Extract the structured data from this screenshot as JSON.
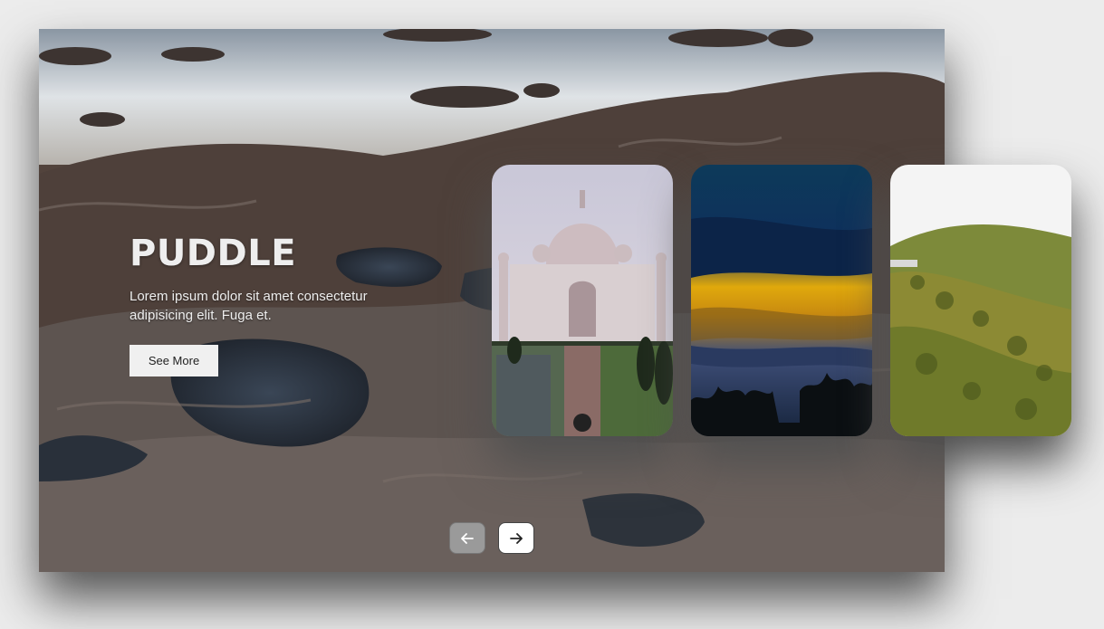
{
  "slide": {
    "title": "PUDDLE",
    "description": "Lorem ipsum dolor sit amet consectetur adipisicing elit. Fuga et.",
    "button_label": "See More",
    "background_image": "rocky-shore-tide-pools"
  },
  "cards": [
    {
      "image": "taj-mahal"
    },
    {
      "image": "sunset-sky-silhouette-trees"
    },
    {
      "image": "green-forested-hillside"
    }
  ],
  "navigation": {
    "prev_icon": "arrow-left-icon",
    "next_icon": "arrow-right-icon"
  }
}
